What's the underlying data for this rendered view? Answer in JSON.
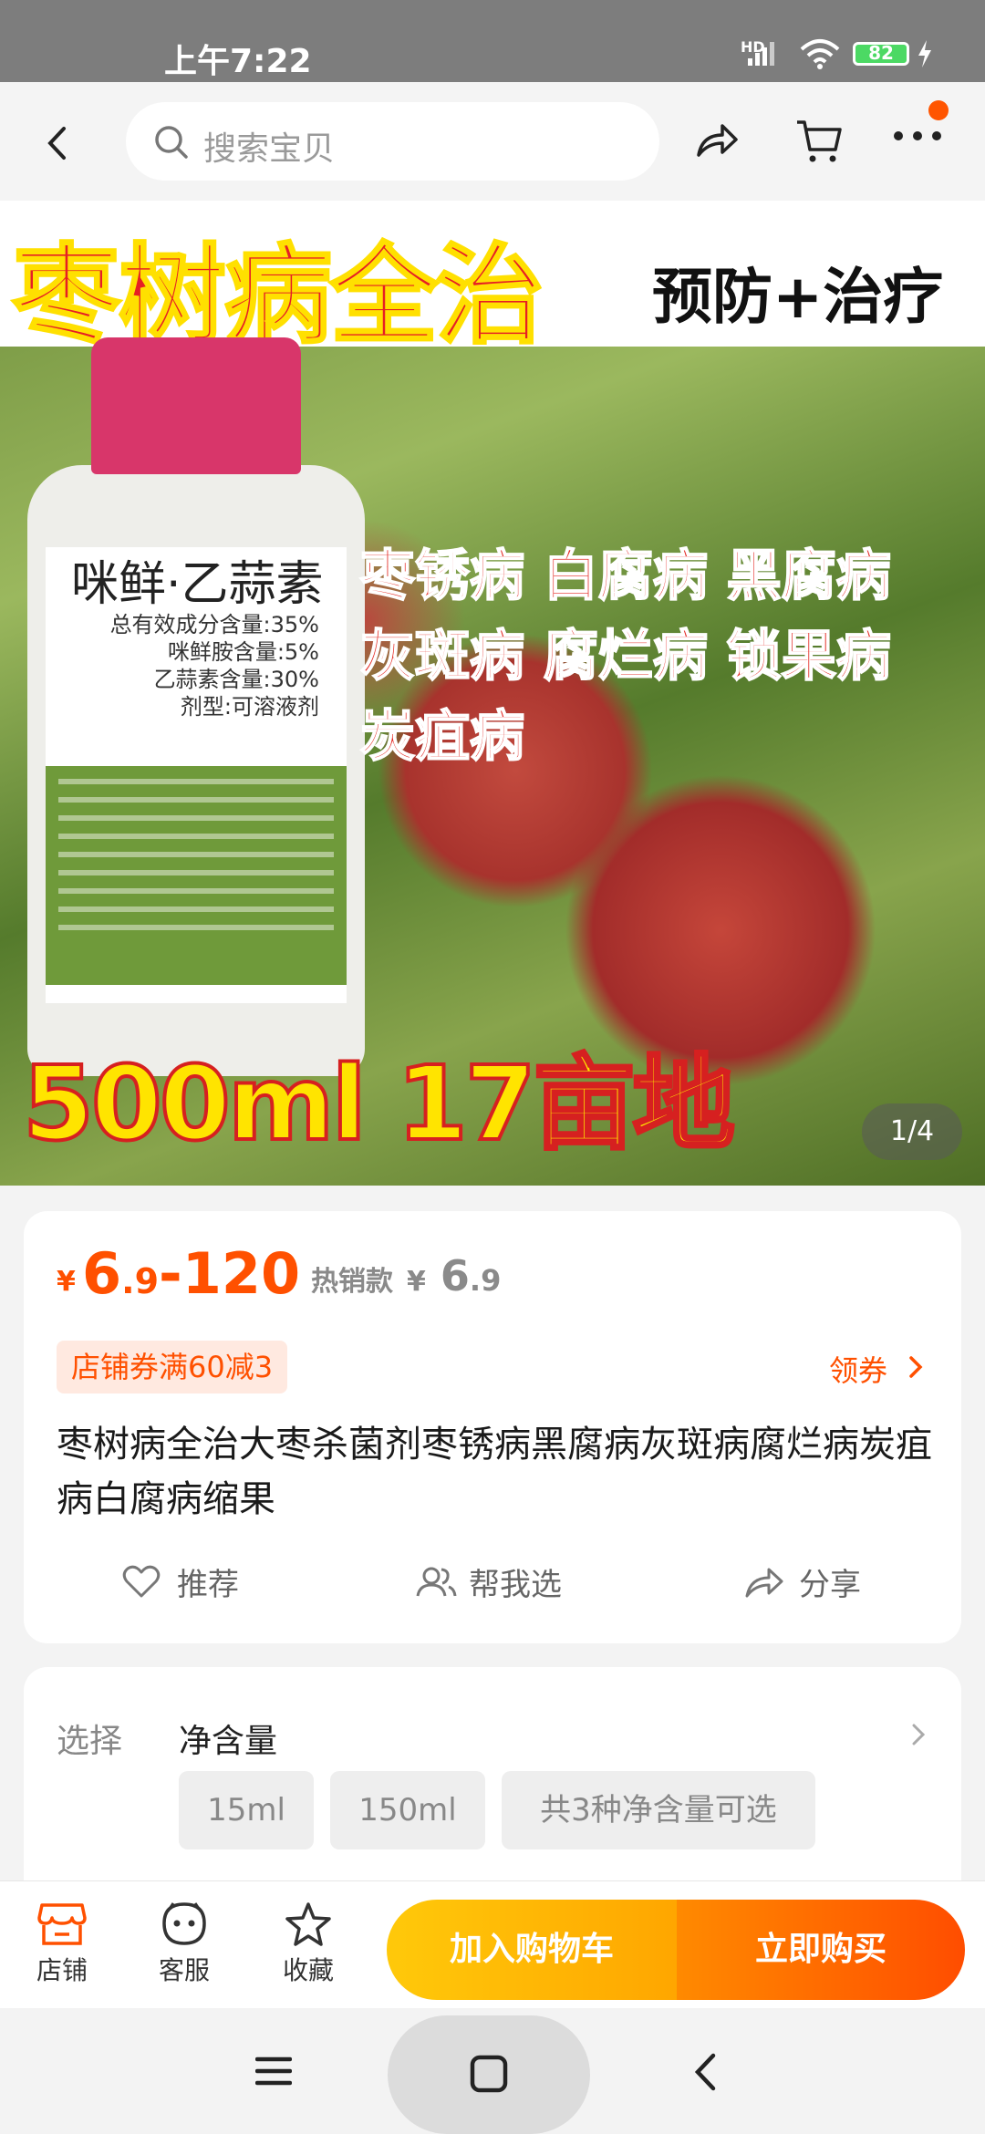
{
  "status_bar": {
    "time": "上午7:22",
    "network": "HD",
    "battery": "82"
  },
  "search": {
    "placeholder": "搜索宝贝"
  },
  "banner": {
    "title": "枣树病全治",
    "subtitle": "预防+治疗",
    "bottle_name": "咪鲜·乙蒜素",
    "bottle_lines": [
      "总有效成分含量:35%",
      "咪鲜胺含量:5%",
      "乙蒜素含量:30%",
      "剂型:可溶液剂"
    ],
    "diseases": [
      "枣锈病 白腐病 黑腐病",
      "灰斑病 腐烂病 锁果病",
      "炭疽病"
    ],
    "bottom_text": "500ml 17亩地",
    "page_indicator": "1/4"
  },
  "product": {
    "currency": "¥",
    "price_main": "6",
    "price_decimal": ".9",
    "price_max": "-120",
    "hot_label": "热销款",
    "hot_price_currency": "¥",
    "hot_price_main": "6",
    "hot_price_decimal": ".9",
    "coupon": "店铺券满60减3",
    "claim_coupon": "领券",
    "title": "枣树病全治大枣杀菌剂枣锈病黑腐病灰斑病腐烂病炭疽病白腐病缩果",
    "actions": {
      "recommend": "推荐",
      "help_choose": "帮我选",
      "share": "分享"
    }
  },
  "options": {
    "label": "选择",
    "name": "净含量",
    "chips": [
      "15ml",
      "150ml",
      "共3种净含量可选"
    ]
  },
  "bottom_bar": {
    "shop": "店铺",
    "service": "客服",
    "favorite": "收藏",
    "add_to_cart": "加入购物车",
    "buy_now": "立即购买"
  },
  "colors": {
    "accent": "#ff5000",
    "cart_button": "#ffb400",
    "buy_button": "#ff5a00"
  }
}
